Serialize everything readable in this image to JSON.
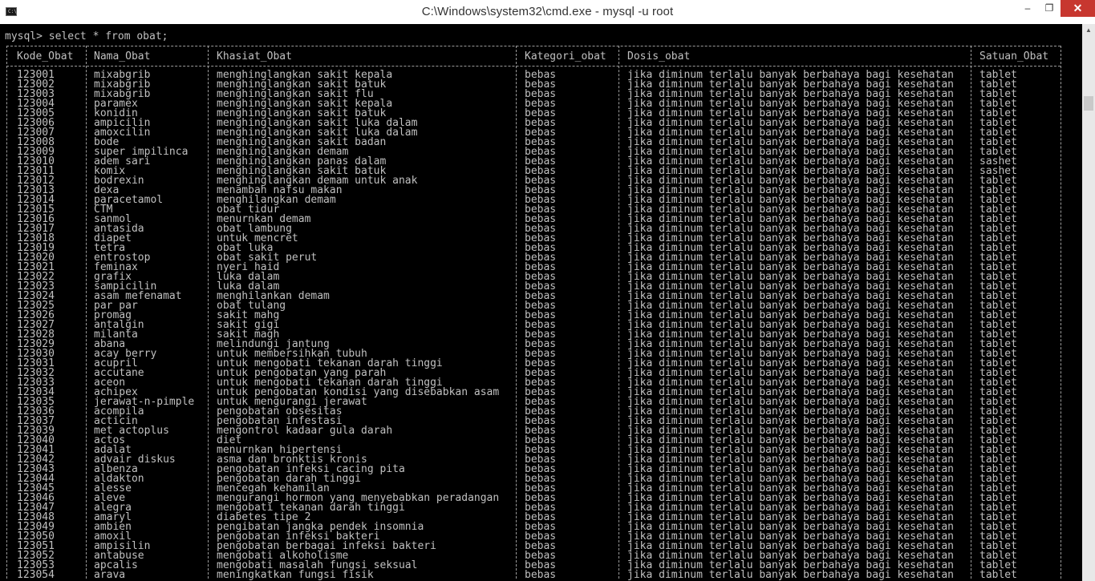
{
  "window": {
    "title": "C:\\Windows\\system32\\cmd.exe - mysql  -u root",
    "icon_text": "C:\\",
    "minimize": "–",
    "maximize": "❐",
    "close": "✕"
  },
  "console": {
    "prompt": "mysql> select * from obat;",
    "columns": [
      "Kode_Obat",
      "Nama_Obat",
      "Khasiat_Obat",
      "Kategori_obat",
      "Dosis_obat",
      "Satuan_Obat"
    ],
    "rows": [
      [
        "123001",
        "mixabgrib",
        "menghinglangkan sakit kepala",
        "bebas",
        "jika diminum terlalu banyak berbahaya bagi kesehatan",
        "tablet"
      ],
      [
        "123002",
        "mixabgrib",
        "menghinglangkan sakit batuk",
        "bebas",
        "jika diminum terlalu banyak berbahaya bagi kesehatan",
        "tablet"
      ],
      [
        "123003",
        "mixabgrib",
        "menghinglangkan sakit flu",
        "bebas",
        "jika diminum terlalu banyak berbahaya bagi kesehatan",
        "tablet"
      ],
      [
        "123004",
        "paramex",
        "menghinglangkan sakit kepala",
        "bebas",
        "jika diminum terlalu banyak berbahaya bagi kesehatan",
        "tablet"
      ],
      [
        "123005",
        "konidin",
        "menghinglangkan sakit batuk",
        "bebas",
        "jika diminum terlalu banyak berbahaya bagi kesehatan",
        "tablet"
      ],
      [
        "123006",
        "ampicilin",
        "menghinglangkan sakit luka dalam",
        "bebas",
        "jika diminum terlalu banyak berbahaya bagi kesehatan",
        "tablet"
      ],
      [
        "123007",
        "amoxcilin",
        "menghinglangkan sakit luka dalam",
        "bebas",
        "jika diminum terlalu banyak berbahaya bagi kesehatan",
        "tablet"
      ],
      [
        "123008",
        "bode",
        "menghinglangkan sakit badan",
        "bebas",
        "jika diminum terlalu banyak berbahaya bagi kesehatan",
        "tablet"
      ],
      [
        "123009",
        "super impilinca",
        "menghinglangkan demam",
        "bebas",
        "jika diminum terlalu banyak berbahaya bagi kesehatan",
        "tablet"
      ],
      [
        "123010",
        "adem sari",
        "menghinglangkan panas dalam",
        "bebas",
        "jika diminum terlalu banyak berbahaya bagi kesehatan",
        "sashet"
      ],
      [
        "123011",
        "komix",
        "menghinglangkan sakit batuk",
        "bebas",
        "jika diminum terlalu banyak berbahaya bagi kesehatan",
        "sashet"
      ],
      [
        "123012",
        "bodrexin",
        "menghinglangkan demam untuk anak",
        "bebas",
        "jika diminum terlalu banyak berbahaya bagi kesehatan",
        "tablet"
      ],
      [
        "123013",
        "dexa",
        "menambah nafsu makan",
        "bebas",
        "jika diminum terlalu banyak berbahaya bagi kesehatan",
        "tablet"
      ],
      [
        "123014",
        "paracetamol",
        "menghilangkan demam",
        "bebas",
        "jika diminum terlalu banyak berbahaya bagi kesehatan",
        "tablet"
      ],
      [
        "123015",
        "CTM",
        "obat tidur",
        "bebas",
        "jika diminum terlalu banyak berbahaya bagi kesehatan",
        "tablet"
      ],
      [
        "123016",
        "sanmol",
        "menurnkan demam",
        "bebas",
        "jika diminum terlalu banyak berbahaya bagi kesehatan",
        "tablet"
      ],
      [
        "123017",
        "antasida",
        "obat lambung",
        "bebas",
        "jika diminum terlalu banyak berbahaya bagi kesehatan",
        "tablet"
      ],
      [
        "123018",
        "diapet",
        "untuk mencret",
        "bebas",
        "jika diminum terlalu banyak berbahaya bagi kesehatan",
        "tablet"
      ],
      [
        "123019",
        "tetra",
        "obat luka",
        "bebas",
        "jika diminum terlalu banyak berbahaya bagi kesehatan",
        "tablet"
      ],
      [
        "123020",
        "entrostop",
        "obat sakit perut",
        "bebas",
        "jika diminum terlalu banyak berbahaya bagi kesehatan",
        "tablet"
      ],
      [
        "123021",
        "feminax",
        "nyeri haid",
        "bebas",
        "jika diminum terlalu banyak berbahaya bagi kesehatan",
        "tablet"
      ],
      [
        "123022",
        "grafix",
        "luka dalam",
        "bebas",
        "jika diminum terlalu banyak berbahaya bagi kesehatan",
        "tablet"
      ],
      [
        "123023",
        "sampicilin",
        "luka dalam",
        "bebas",
        "jika diminum terlalu banyak berbahaya bagi kesehatan",
        "tablet"
      ],
      [
        "123024",
        "asam mefenamat",
        "menghilankan demam",
        "bebas",
        "jika diminum terlalu banyak berbahaya bagi kesehatan",
        "tablet"
      ],
      [
        "123025",
        "par par",
        "obat tulang",
        "bebas",
        "jika diminum terlalu banyak berbahaya bagi kesehatan",
        "tablet"
      ],
      [
        "123026",
        "promag",
        "sakit mahg",
        "bebas",
        "jika diminum terlalu banyak berbahaya bagi kesehatan",
        "tablet"
      ],
      [
        "123027",
        "antalgin",
        "sakit gigi",
        "bebas",
        "jika diminum terlalu banyak berbahaya bagi kesehatan",
        "tablet"
      ],
      [
        "123028",
        "milanta",
        "sakit magh",
        "bebas",
        "jika diminum terlalu banyak berbahaya bagi kesehatan",
        "tablet"
      ],
      [
        "123029",
        "abana",
        "melindungi jantung",
        "bebas",
        "jika diminum terlalu banyak berbahaya bagi kesehatan",
        "tablet"
      ],
      [
        "123030",
        "acay berry",
        "untuk membersihkan tubuh",
        "bebas",
        "jika diminum terlalu banyak berbahaya bagi kesehatan",
        "tablet"
      ],
      [
        "123031",
        "acupril",
        "untuk mengobati tekanan darah tinggi",
        "bebas",
        "jika diminum terlalu banyak berbahaya bagi kesehatan",
        "tablet"
      ],
      [
        "123032",
        "accutane",
        "untuk pengobatan yang parah",
        "bebas",
        "jika diminum terlalu banyak berbahaya bagi kesehatan",
        "tablet"
      ],
      [
        "123033",
        "aceon",
        "untuk mengobati tekanan darah tinggi",
        "bebas",
        "jika diminum terlalu banyak berbahaya bagi kesehatan",
        "tablet"
      ],
      [
        "123034",
        "achipex",
        "untuk pengobatan kondisi yang disebabkan asam",
        "bebas",
        "jika diminum terlalu banyak berbahaya bagi kesehatan",
        "tablet"
      ],
      [
        "123035",
        "jerawat-n-pimple",
        "untuk mengurangi jerawat",
        "bebas",
        "jika diminum terlalu banyak berbahaya bagi kesehatan",
        "tablet"
      ],
      [
        "123036",
        "acompila",
        "pengobatan obsesitas",
        "bebas",
        "jika diminum terlalu banyak berbahaya bagi kesehatan",
        "tablet"
      ],
      [
        "123037",
        "acticin",
        "pengobatan infestasi",
        "bebas",
        "jika diminum terlalu banyak berbahaya bagi kesehatan",
        "tablet"
      ],
      [
        "123039",
        "met actoplus",
        "mengontrol kadaar gula darah",
        "bebas",
        "jika diminum terlalu banyak berbahaya bagi kesehatan",
        "tablet"
      ],
      [
        "123040",
        "actos",
        "diet",
        "bebas",
        "jika diminum terlalu banyak berbahaya bagi kesehatan",
        "tablet"
      ],
      [
        "123041",
        "adalat",
        "menurnkan hipertensi",
        "bebas",
        "jika diminum terlalu banyak berbahaya bagi kesehatan",
        "tablet"
      ],
      [
        "123042",
        "advair diskus",
        "asma dan bronktis kronis",
        "bebas",
        "jika diminum terlalu banyak berbahaya bagi kesehatan",
        "tablet"
      ],
      [
        "123043",
        "albenza",
        "pengobatan infeksi cacing pita",
        "bebas",
        "jika diminum terlalu banyak berbahaya bagi kesehatan",
        "tablet"
      ],
      [
        "123044",
        "aldakton",
        "pengobatan darah tinggi",
        "bebas",
        "jika diminum terlalu banyak berbahaya bagi kesehatan",
        "tablet"
      ],
      [
        "123045",
        "alesse",
        "mencegah kehamilan",
        "bebas",
        "jika diminum terlalu banyak berbahaya bagi kesehatan",
        "tablet"
      ],
      [
        "123046",
        "aleve",
        "mengurangi hormon yang menyebabkan peradangan",
        "bebas",
        "jika diminum terlalu banyak berbahaya bagi kesehatan",
        "tablet"
      ],
      [
        "123047",
        "alegra",
        "mengobati tekanan darah tinggi",
        "bebas",
        "jika diminum terlalu banyak berbahaya bagi kesehatan",
        "tablet"
      ],
      [
        "123048",
        "amaryl",
        "diabetes tipe 2",
        "bebas",
        "jika diminum terlalu banyak berbahaya bagi kesehatan",
        "tablet"
      ],
      [
        "123049",
        "ambien",
        "pengibatan jangka pendek insomnia",
        "bebas",
        "jika diminum terlalu banyak berbahaya bagi kesehatan",
        "tablet"
      ],
      [
        "123050",
        "amoxil",
        "pengobatan infeksi bakteri",
        "bebas",
        "jika diminum terlalu banyak berbahaya bagi kesehatan",
        "tablet"
      ],
      [
        "123051",
        "ampisilin",
        "pengobatan berbagai infeksi bakteri",
        "bebas",
        "jika diminum terlalu banyak berbahaya bagi kesehatan",
        "tablet"
      ],
      [
        "123052",
        "antabuse",
        "mengobati alkoholisme",
        "bebas",
        "jika diminum terlalu banyak berbahaya bagi kesehatan",
        "tablet"
      ],
      [
        "123053",
        "apcalis",
        "mengobati masalah fungsi seksual",
        "bebas",
        "jika diminum terlalu banyak berbahaya bagi kesehatan",
        "tablet"
      ],
      [
        "123054",
        "arava",
        "meningkatkan fungsi fisik",
        "bebas",
        "jika diminum terlalu banyak berbahaya bagi kesehatan",
        "tablet"
      ]
    ]
  }
}
